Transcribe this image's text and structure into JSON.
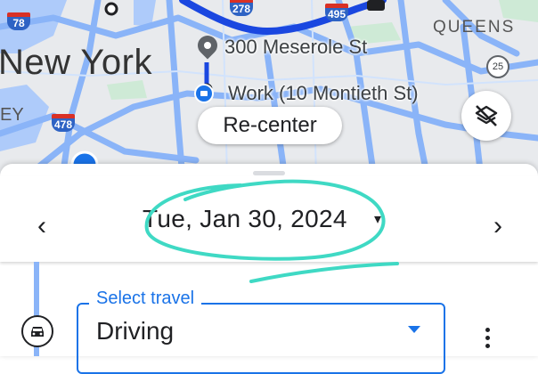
{
  "map": {
    "city_label": "New York",
    "borough_label": "QUEENS",
    "partial_label": "EY",
    "highways": [
      {
        "label": "278",
        "kind": "interstate"
      },
      {
        "label": "495",
        "kind": "interstate"
      },
      {
        "label": "478",
        "kind": "interstate"
      },
      {
        "label": "78",
        "kind": "interstate"
      },
      {
        "label": "25",
        "kind": "state"
      }
    ],
    "origin_label": "300 Meserole St",
    "destination_label": "Work (10 Montieth St)",
    "recenter_label": "Re-center",
    "colors": {
      "route": "#1a47e0",
      "roads": "#8ab4f8",
      "water": "#aecbfa",
      "park": "#ceead6"
    }
  },
  "date_bar": {
    "prev_label": "‹",
    "date": "Tue, Jan 30, 2024",
    "next_label": "›",
    "annotation_color": "#3fd9c4"
  },
  "travel": {
    "select_label": "Select travel",
    "selected_mode": "Driving",
    "mode_icon": "car-icon",
    "more_icon": "more-vert-icon"
  }
}
